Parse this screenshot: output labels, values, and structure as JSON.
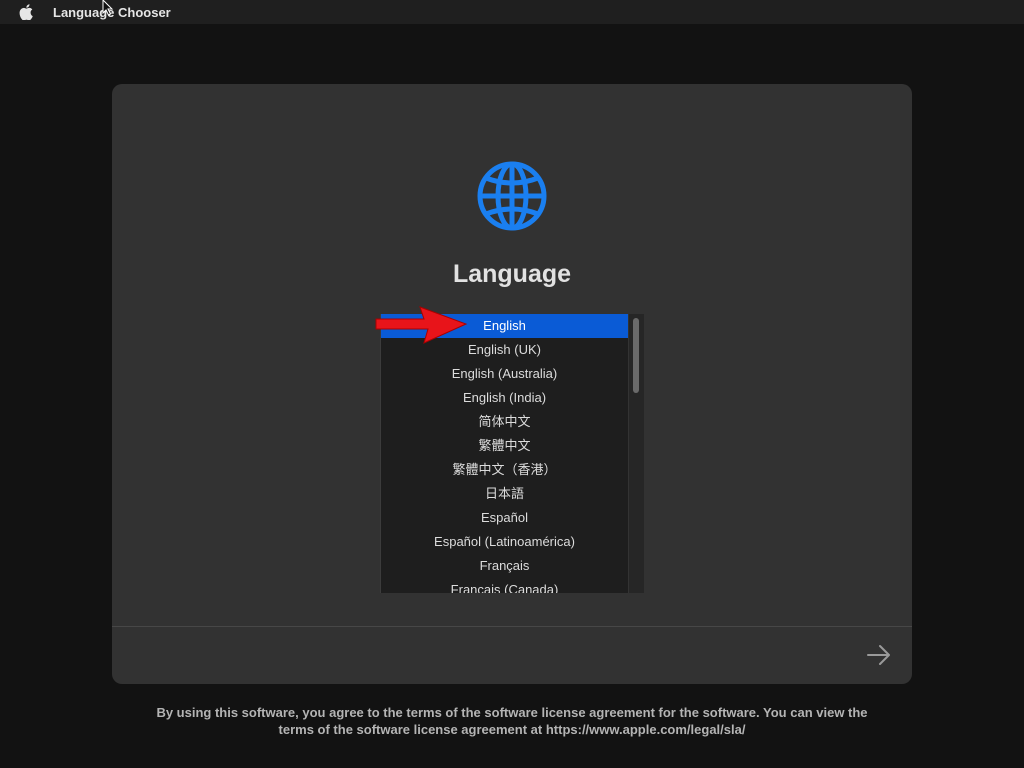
{
  "menubar": {
    "apple_icon": "apple-logo-icon",
    "app_title": "Language Chooser"
  },
  "panel": {
    "icon": "globe-icon",
    "heading": "Language",
    "languages": [
      {
        "label": "English",
        "selected": true
      },
      {
        "label": "English (UK)",
        "selected": false
      },
      {
        "label": "English (Australia)",
        "selected": false
      },
      {
        "label": "English (India)",
        "selected": false
      },
      {
        "label": "简体中文",
        "selected": false
      },
      {
        "label": "繁體中文",
        "selected": false
      },
      {
        "label": "繁體中文（香港）",
        "selected": false
      },
      {
        "label": "日本語",
        "selected": false
      },
      {
        "label": "Español",
        "selected": false
      },
      {
        "label": "Español (Latinoamérica)",
        "selected": false
      },
      {
        "label": "Français",
        "selected": false
      },
      {
        "label": "Français (Canada)",
        "selected": false
      }
    ],
    "next_button_icon": "arrow-right-icon"
  },
  "footer": {
    "line1": "By using this software, you agree to the terms of the software license agreement for the software. You can view the",
    "line2": "terms of the software license agreement at https://www.apple.com/legal/sla/"
  },
  "colors": {
    "accent_blue": "#0a5bd6",
    "globe_blue": "#1a7ff0",
    "annotation_red": "#e8141a"
  }
}
